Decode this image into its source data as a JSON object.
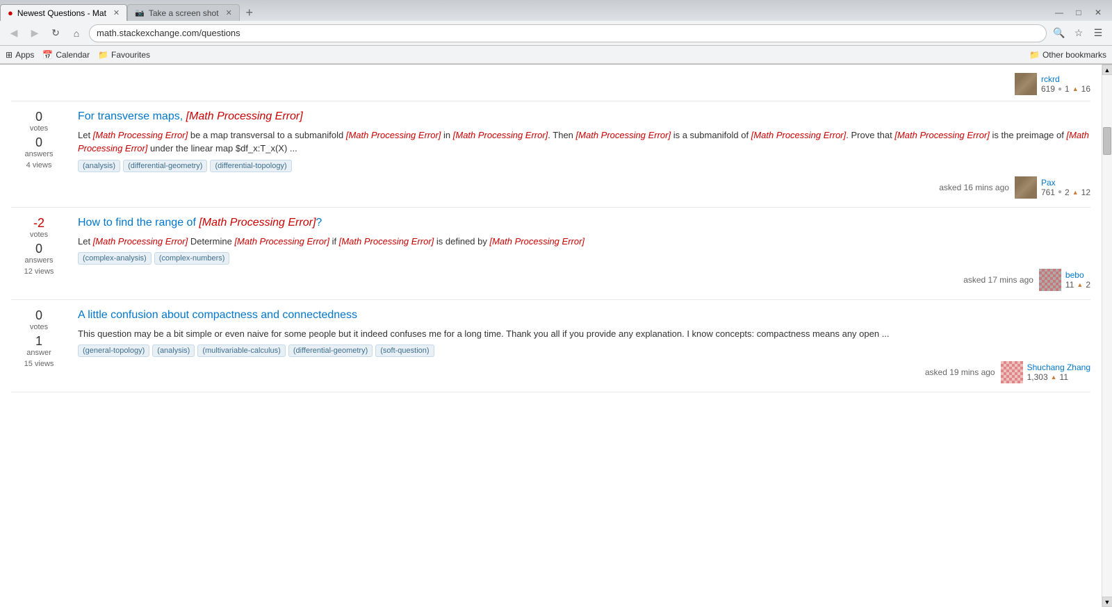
{
  "browser": {
    "tabs": [
      {
        "id": "tab1",
        "label": "Newest Questions - Mat",
        "favicon": "🔴",
        "active": true,
        "closable": true
      },
      {
        "id": "tab2",
        "label": "Take a screen shot",
        "favicon": "📸",
        "active": false,
        "closable": true
      }
    ],
    "nav": {
      "back_disabled": false,
      "forward_disabled": true,
      "reload_label": "↻",
      "home_label": "⌂",
      "url": "math.stackexchange.com/questions"
    },
    "bookmarks": [
      {
        "id": "apps",
        "label": "Apps",
        "icon": "⊞"
      },
      {
        "id": "calendar",
        "label": "Calendar",
        "icon": "📅"
      },
      {
        "id": "favourites",
        "label": "Favourites",
        "icon": "📁"
      }
    ],
    "other_bookmarks": "Other bookmarks"
  },
  "page": {
    "partial_user": {
      "name": "rckrd",
      "rep": "619",
      "silver": "1",
      "bronze": "16"
    },
    "questions": [
      {
        "id": "q1",
        "votes": "0",
        "answers": "0",
        "views": "4",
        "title_prefix": "For transverse maps, ",
        "title_math": "[Math Processing Error]",
        "excerpt_parts": [
          "Let ",
          "[Math Processing Error]",
          " be a map transversal to a submanifold ",
          "[Math Processing Error]",
          " in ",
          "[Math Processing Error]",
          ". Then ",
          "[Math Processing Error]",
          " is a submanifold of ",
          "[Math Processing Error]",
          ". Prove that ",
          "[Math Processing Error]",
          " is the preimage of ",
          "[Math Processing Error]",
          " under the linear map $df_x:T_x(X) ..."
        ],
        "tags": [
          "analysis",
          "differential-geometry",
          "differential-topology"
        ],
        "asked_time": "asked 16 mins ago",
        "user_name": "Pax",
        "user_rep": "761",
        "user_silver": "2",
        "user_bronze": "12",
        "avatar_type": "brown"
      },
      {
        "id": "q2",
        "votes": "-2",
        "votes_negative": true,
        "answers": "0",
        "views": "12",
        "title_prefix": "How to find the range of ",
        "title_math": "[Math Processing Error]",
        "title_suffix": "?",
        "excerpt_parts": [
          "Let ",
          "[Math Processing Error]",
          " Determine ",
          "[Math Processing Error]",
          " if ",
          "[Math Processing Error]",
          " is defined by ",
          "[Math Processing Error]"
        ],
        "tags": [
          "complex-analysis",
          "complex-numbers"
        ],
        "asked_time": "asked 17 mins ago",
        "user_name": "bebo",
        "user_rep": "11",
        "user_bronze": "2",
        "avatar_type": "colorful"
      },
      {
        "id": "q3",
        "votes": "0",
        "answers": "1",
        "views": "15",
        "title": "A little confusion about compactness and connectedness",
        "excerpt": "This question may be a bit simple or even naive for some people but it indeed confuses me for a long time. Thank you all if you provide any explanation. I know concepts: compactness means any open ...",
        "tags": [
          "general-topology",
          "analysis",
          "multivariable-calculus",
          "differential-geometry",
          "soft-question"
        ],
        "asked_time": "asked 19 mins ago",
        "user_name": "Shuchang Zhang",
        "user_rep": "1,303",
        "user_bronze": "11",
        "avatar_type": "pink"
      }
    ]
  },
  "scrollbar": {
    "up_arrow": "▲",
    "down_arrow": "▼"
  }
}
